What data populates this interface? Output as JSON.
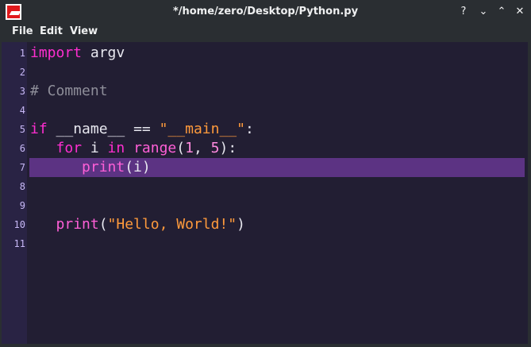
{
  "window": {
    "title": "*/home/zero/Desktop/Python.py",
    "buttons": {
      "help": "?",
      "minimize": "⌄",
      "maximize": "⌃",
      "close": "✕"
    }
  },
  "menu": [
    "File",
    "Edit",
    "View"
  ],
  "editor": {
    "line_numbers": [
      "1",
      "2",
      "3",
      "4",
      "5",
      "6",
      "7",
      "8",
      "9",
      "10",
      "11"
    ],
    "current_line": 7,
    "lines": [
      [
        {
          "t": "import",
          "c": "kw"
        },
        {
          "t": " argv",
          "c": "op"
        }
      ],
      [],
      [
        {
          "t": "# Comment",
          "c": "com"
        }
      ],
      [],
      [
        {
          "t": "if",
          "c": "kw"
        },
        {
          "t": " __name__ ",
          "c": "op"
        },
        {
          "t": "==",
          "c": "op"
        },
        {
          "t": " ",
          "c": "op"
        },
        {
          "t": "\"__main__\"",
          "c": "str"
        },
        {
          "t": ":",
          "c": "op"
        }
      ],
      [
        {
          "t": "   ",
          "c": "op"
        },
        {
          "t": "for",
          "c": "kw"
        },
        {
          "t": " i ",
          "c": "op"
        },
        {
          "t": "in",
          "c": "kw"
        },
        {
          "t": " ",
          "c": "op"
        },
        {
          "t": "range",
          "c": "fn"
        },
        {
          "t": "(",
          "c": "op"
        },
        {
          "t": "1",
          "c": "num"
        },
        {
          "t": ", ",
          "c": "op"
        },
        {
          "t": "5",
          "c": "num"
        },
        {
          "t": "):",
          "c": "op"
        }
      ],
      [
        {
          "t": "      ",
          "c": "op"
        },
        {
          "t": "print",
          "c": "fn"
        },
        {
          "t": "(i)",
          "c": "op"
        }
      ],
      [],
      [],
      [
        {
          "t": "   ",
          "c": "op"
        },
        {
          "t": "print",
          "c": "fn"
        },
        {
          "t": "(",
          "c": "op"
        },
        {
          "t": "\"Hello, World!\"",
          "c": "str"
        },
        {
          "t": ")",
          "c": "op"
        }
      ],
      []
    ]
  },
  "colors": {
    "keyword": "#ff2ed0",
    "comment": "#8e8e99",
    "string": "#ff9a3c",
    "number": "#ff8adf",
    "builtin": "#ff5fd7",
    "current_line": "#5c3383",
    "editor_bg": "#221e33",
    "gutter_bg": "#292344"
  }
}
